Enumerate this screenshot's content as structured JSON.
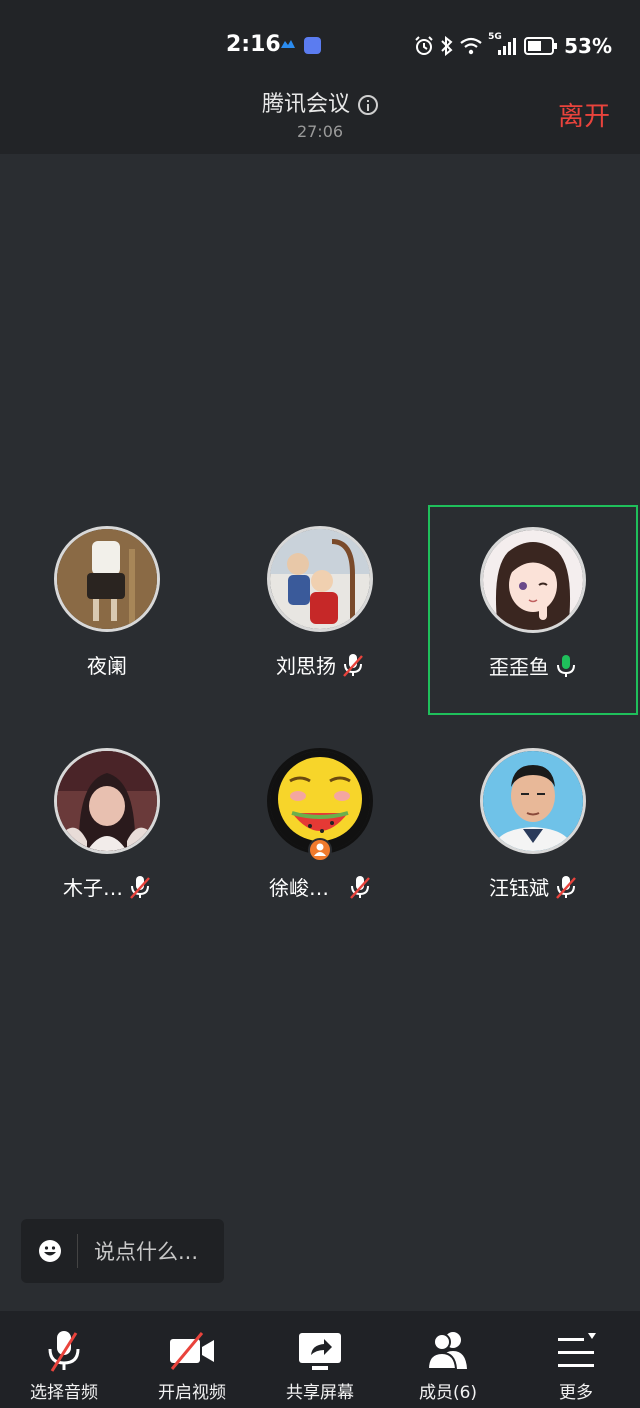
{
  "status_bar": {
    "time": "2:16",
    "battery": "53%",
    "network": "5G"
  },
  "header": {
    "title": "腾讯会议",
    "timer": "27:06",
    "leave_label": "离开"
  },
  "participants": [
    {
      "name": "夜阑",
      "mic": "none",
      "active": false,
      "host": false
    },
    {
      "name": "刘思扬",
      "mic": "muted",
      "active": false,
      "host": false
    },
    {
      "name": "歪歪鱼",
      "mic": "on",
      "active": true,
      "host": false
    },
    {
      "name": "木子…",
      "mic": "muted",
      "active": false,
      "host": false
    },
    {
      "name": "徐峻…",
      "mic": "muted",
      "active": false,
      "host": true
    },
    {
      "name": "汪钰斌",
      "mic": "muted",
      "active": false,
      "host": false
    }
  ],
  "chat": {
    "placeholder": "说点什么..."
  },
  "toolbar": {
    "audio_label": "选择音频",
    "video_label": "开启视频",
    "share_label": "共享屏幕",
    "members_label": "成员(6)",
    "more_label": "更多"
  },
  "colors": {
    "leave": "#e9433c",
    "active_border": "#1fbf5b",
    "mic_muted": "#e9433c",
    "mic_on": "#1fbf5b"
  }
}
